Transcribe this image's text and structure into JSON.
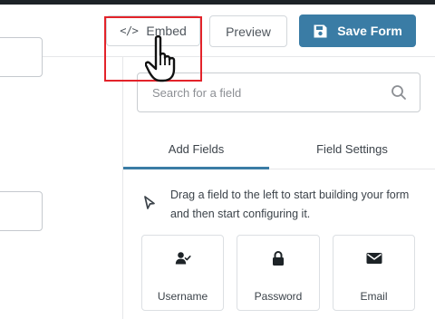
{
  "header": {
    "embed": {
      "code_glyph": "</>",
      "label": "Embed"
    },
    "preview_label": "Preview",
    "save_label": "Save Form",
    "accent_color": "#3a7ca5"
  },
  "search": {
    "placeholder": "Search for a field",
    "value": ""
  },
  "tabs": [
    {
      "label": "Add Fields",
      "active": true
    },
    {
      "label": "Field Settings",
      "active": false
    }
  ],
  "hint": "Drag a field to the left to start building your form and then start configuring it.",
  "fields": [
    {
      "label": "Username",
      "icon": "user-check-icon"
    },
    {
      "label": "Password",
      "icon": "lock-icon"
    },
    {
      "label": "Email",
      "icon": "envelope-icon"
    }
  ],
  "annotation": {
    "highlight_color": "#e3232a",
    "cursor": "hand-pointer-icon"
  }
}
